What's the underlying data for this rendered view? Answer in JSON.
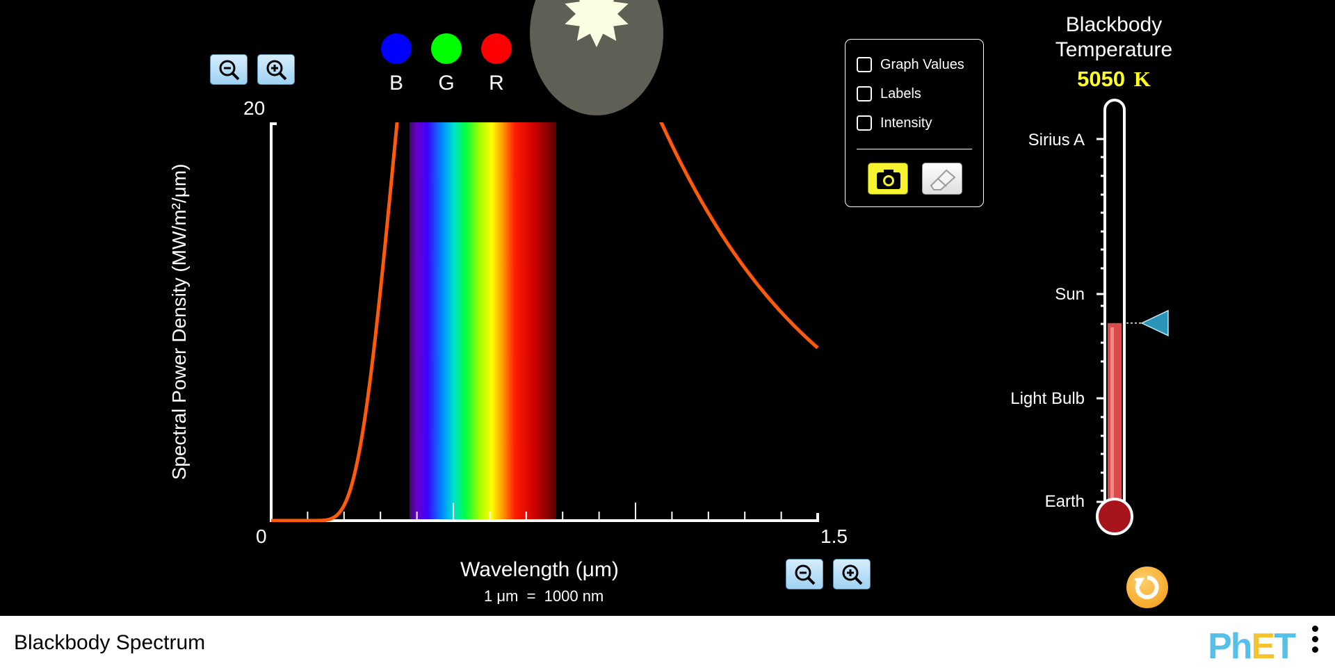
{
  "graph": {
    "y_axis_label": "Spectral Power Density (MW/m²/μm)",
    "y_max_label": "20",
    "y_min_label": "0",
    "x_max_label": "1.5",
    "x_axis_label": "Wavelength (μm)",
    "x_unit_note": "1 μm  =  1000 nm",
    "curve_color": "#ff5a0a"
  },
  "rgb": {
    "dots": [
      {
        "label": "B",
        "color": "#0000ff"
      },
      {
        "label": "G",
        "color": "#00ff00"
      },
      {
        "label": "R",
        "color": "#ff0000"
      }
    ]
  },
  "options": {
    "graph_values": {
      "label": "Graph Values",
      "checked": false
    },
    "labels": {
      "label": "Labels",
      "checked": false
    },
    "intensity": {
      "label": "Intensity",
      "checked": false
    }
  },
  "thermometer": {
    "title_line1": "Blackbody",
    "title_line2": "Temperature",
    "temperature_value": "5050",
    "temperature_unit": "K",
    "temperature_k": 5050,
    "markers": {
      "sirius_a": "Sirius A",
      "sun": "Sun",
      "light_bulb": "Light Bulb",
      "earth": "Earth"
    }
  },
  "footer": {
    "sim_title": "Blackbody Spectrum",
    "logo_text_p": "Ph",
    "logo_text_i": "E",
    "logo_text_t": "T"
  },
  "colors": {
    "accent_yellow": "#ffff24",
    "zoom_button_blue": "#9fd2f3",
    "camera_button_yellow": "#f6f330",
    "reset_orange": "#f29a12",
    "slider_arrow": "#2a95b8",
    "thermometer_fill": "#d94a4a"
  }
}
